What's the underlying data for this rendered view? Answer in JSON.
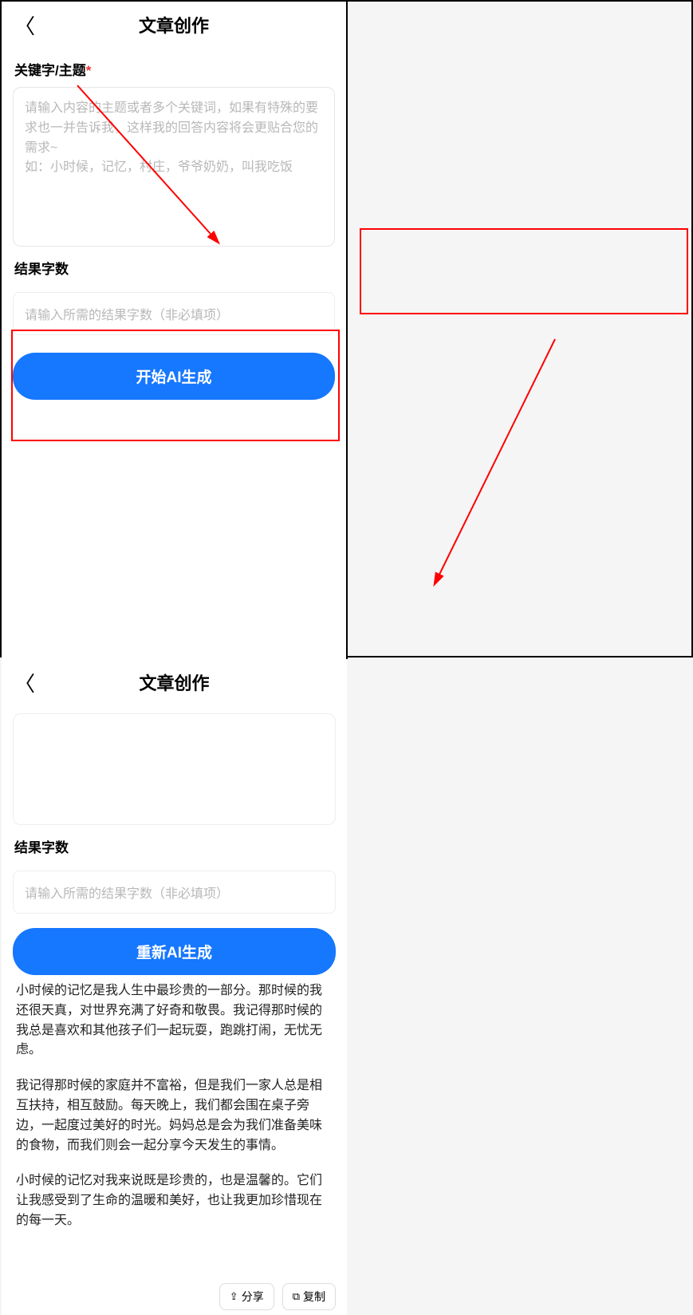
{
  "left": {
    "header": {
      "title": "文章创作"
    },
    "keywordSection": {
      "label": "关键字/主题",
      "requiredMark": "*",
      "placeholder": "请输入内容的主题或者多个关键词，如果有特殊的要求也一并告诉我，这样我的回答内容将会更贴合您的需求~\n如：小时候，记忆，村庄，爷爷奶奶，叫我吃饭"
    },
    "resultCount": {
      "label": "结果字数",
      "placeholder": "请输入所需的结果字数（非必填项）"
    },
    "generateBtn": "开始AI生成"
  },
  "right": {
    "header": {
      "title": "文章创作"
    },
    "resultCount": {
      "label": "结果字数",
      "placeholder": "请输入所需的结果字数（非必填项）"
    },
    "regenBtn": "重新AI生成",
    "output": {
      "p1": "小时候的记忆是我人生中最珍贵的一部分。那时候的我还很天真，对世界充满了好奇和敬畏。我记得那时候的我总是喜欢和其他孩子们一起玩耍，跑跳打闹，无忧无虑。",
      "p2": "我记得那时候的家庭并不富裕，但是我们一家人总是相互扶持，相互鼓励。每天晚上，我们都会围在桌子旁边，一起度过美好的时光。妈妈总是会为我们准备美味的食物，而我们则会一起分享今天发生的事情。",
      "p3": "小时候的记忆对我来说既是珍贵的，也是温馨的。它们让我感受到了生命的温暖和美好，也让我更加珍惜现在的每一天。"
    },
    "actions": {
      "share": "分享",
      "copy": "复制"
    }
  }
}
